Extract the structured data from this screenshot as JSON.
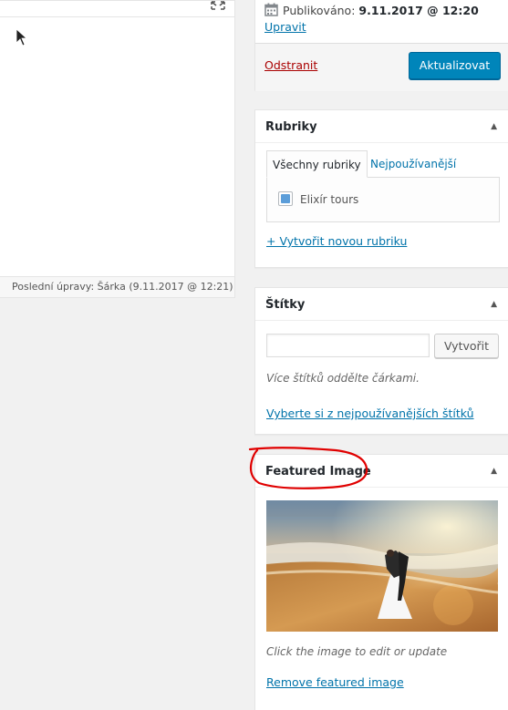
{
  "editor": {
    "last_edit": "Poslední úpravy: Šárka (9.11.2017 @ 12:21)"
  },
  "publish": {
    "published_label": "Publikováno:",
    "published_date": "9.11.2017 @ 12:20",
    "edit_link": "Upravit",
    "delete_link": "Odstranit",
    "update_button": "Aktualizovat"
  },
  "categories": {
    "title": "Rubriky",
    "tab_all": "Všechny rubriky",
    "tab_popular": "Nejpoužívanější",
    "items": [
      {
        "label": "Elixír tours",
        "checked": true
      }
    ],
    "add_link": "+ Vytvořit novou rubriku"
  },
  "tags": {
    "title": "Štítky",
    "input_value": "",
    "create_button": "Vytvořit",
    "hint": "Více štítků oddělte čárkami.",
    "choose_link": "Vyberte si z nejpoužívanějších štítků"
  },
  "featured_image": {
    "title": "Featured Image",
    "hint": "Click the image to edit or update",
    "remove_link": "Remove featured image"
  },
  "colors": {
    "link": "#0073aa",
    "delete": "#aa0000",
    "primary_button": "#0085ba",
    "annotation": "#e00000"
  },
  "icons": {
    "toggle": "triangle-up-icon",
    "fullscreen": "expand-icon",
    "calendar": "calendar-icon"
  }
}
